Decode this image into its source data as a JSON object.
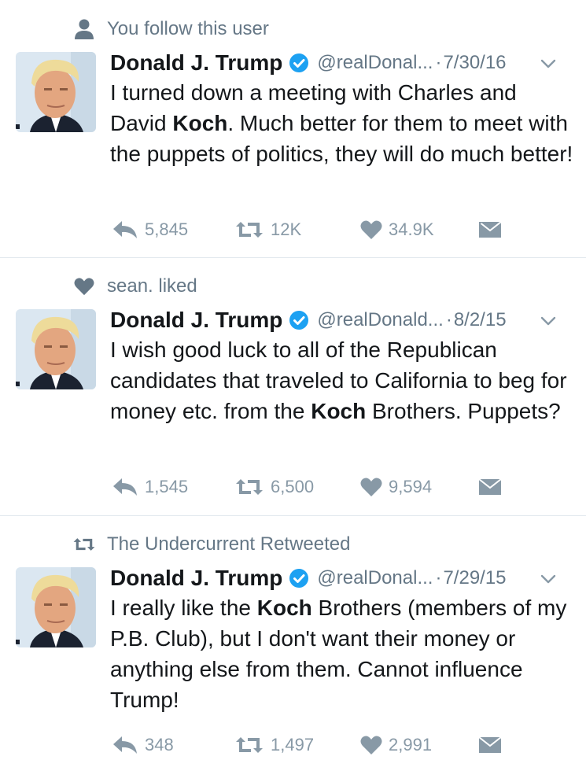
{
  "colors": {
    "text": "#14171a",
    "secondary": "#657786",
    "action": "#8899a6",
    "verified": "#1da1f2",
    "divider": "#e1e8ed"
  },
  "tweets": [
    {
      "context": {
        "icon": "person-icon",
        "text": "You follow this user"
      },
      "name": "Donald J. Trump",
      "handle": "@realDonal...",
      "date": "7/30/16",
      "text_parts": [
        "I turned down a meeting with Charles and David ",
        "Koch",
        ". Much better for them to meet with the puppets of politics, they will do much better!"
      ],
      "replies": "5,845",
      "retweets": "12K",
      "likes": "34.9K"
    },
    {
      "context": {
        "icon": "heart-icon",
        "text": "sean. liked"
      },
      "name": "Donald J. Trump",
      "handle": "@realDonald...",
      "date": "8/2/15",
      "text_parts": [
        "I wish good luck to all of the Republican candidates that traveled to California to beg for money etc. from the ",
        "Koch",
        " Brothers. Puppets?"
      ],
      "replies": "1,545",
      "retweets": "6,500",
      "likes": "9,594"
    },
    {
      "context": {
        "icon": "retweet-icon",
        "text": "The Undercurrent Retweeted"
      },
      "name": "Donald J. Trump",
      "handle": "@realDonal...",
      "date": "7/29/15",
      "text_parts": [
        "I really like the ",
        "Koch",
        " Brothers (members of my P.B. Club), but I don't want their money or anything else from them. Cannot influence Trump!"
      ],
      "replies": "348",
      "retweets": "1,497",
      "likes": "2,991"
    }
  ],
  "dot": "·"
}
